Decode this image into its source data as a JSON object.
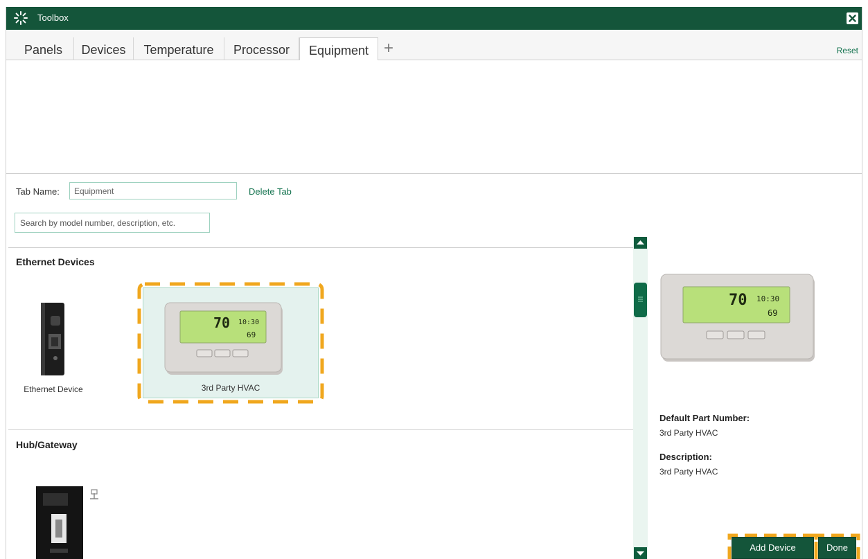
{
  "window": {
    "title": "Toolbox",
    "accent_color": "#14553a",
    "highlight_color": "#f0a71e"
  },
  "tabs": [
    {
      "label": "Panels",
      "active": false
    },
    {
      "label": "Devices",
      "active": false
    },
    {
      "label": "Temperature",
      "active": false
    },
    {
      "label": "Processor",
      "active": false
    },
    {
      "label": "Equipment",
      "active": true
    }
  ],
  "tab_add_symbol": "+",
  "reset_label": "Reset",
  "tab_name": {
    "label": "Tab Name:",
    "value": "Equipment",
    "delete_label": "Delete Tab"
  },
  "search": {
    "placeholder": "Search by model number, description, etc."
  },
  "sections": [
    {
      "title": "Ethernet Devices",
      "items": [
        {
          "label": "Ethernet Device",
          "icon": "ethernet-device-icon",
          "selected": false
        },
        {
          "label": "3rd Party HVAC",
          "icon": "thermostat-icon",
          "selected": true
        }
      ]
    },
    {
      "title": "Hub/Gateway",
      "items": [
        {
          "label": "",
          "icon": "hub-gateway-icon",
          "selected": false
        }
      ]
    }
  ],
  "thermostat_display": {
    "temperature": "70",
    "time": "10:30",
    "setpoint": "69"
  },
  "details": {
    "part_number_label": "Default Part Number:",
    "part_number_value": "3rd Party HVAC",
    "description_label": "Description:",
    "description_value": "3rd Party HVAC"
  },
  "buttons": {
    "add_device": "Add Device",
    "done": "Done"
  }
}
